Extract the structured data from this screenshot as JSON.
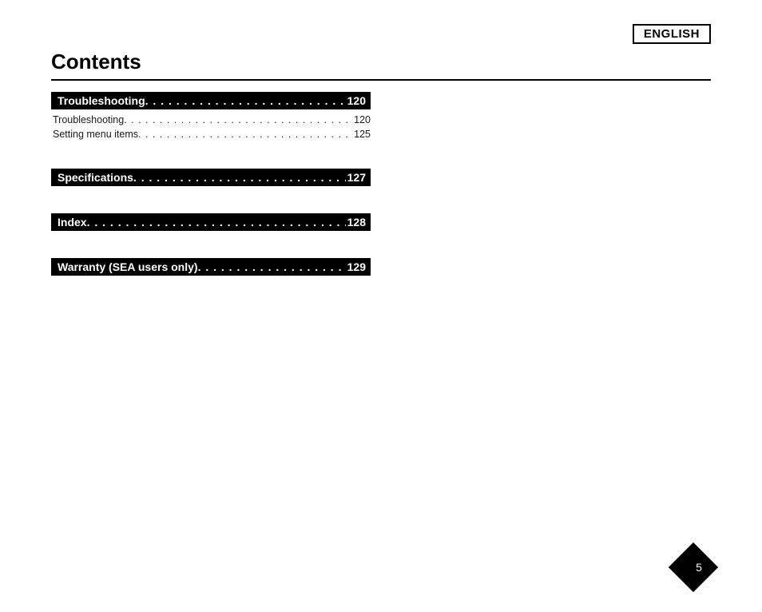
{
  "language_label": "ENGLISH",
  "title": "Contents",
  "dots_long": ". . . . . . . . . . . . . . . . . . . . . . . . . . . . . . . . . . . . . . . . . . . . . . . . . . . . . . . . . . . . . . . . . . . . . . . . . . . . . . . .",
  "sections": [
    {
      "label": "Troubleshooting",
      "page": "120",
      "subs": [
        {
          "label": "Troubleshooting",
          "page": "120"
        },
        {
          "label": "Setting menu items",
          "page": "125"
        }
      ]
    },
    {
      "label": "Specifications",
      "page": "127",
      "subs": []
    },
    {
      "label": "Index",
      "page": "128",
      "subs": []
    },
    {
      "label": "Warranty (SEA users only)",
      "page": "129",
      "subs": []
    }
  ],
  "page_number": "5"
}
